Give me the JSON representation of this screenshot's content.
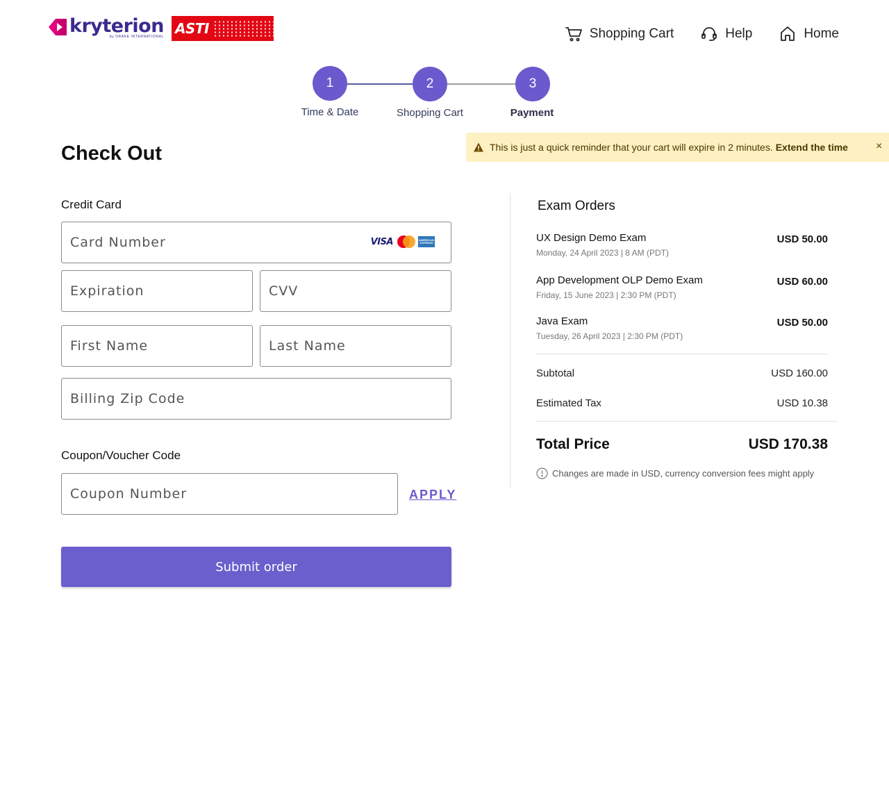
{
  "brand": {
    "logo_name": "kryterion",
    "logo_tagline": "by DRAKE INTERNATIONAL",
    "partner_logo": "ASTI",
    "accent_color": "#6a5acd",
    "partner_color": "#e30613"
  },
  "nav": {
    "items": [
      {
        "label": "Shopping Cart",
        "icon": "cart-icon"
      },
      {
        "label": "Help",
        "icon": "headset-icon"
      },
      {
        "label": "Home",
        "icon": "home-icon"
      }
    ]
  },
  "stepper": {
    "steps": [
      {
        "number": "1",
        "label": "Time & Date",
        "state": "completed"
      },
      {
        "number": "2",
        "label": "Shopping Cart",
        "state": "completed"
      },
      {
        "number": "3",
        "label": "Payment",
        "state": "current"
      }
    ]
  },
  "alert": {
    "message": "This is just a quick reminder that your cart will expire in 2 minutes.",
    "action": "Extend the time",
    "close": "×",
    "icon": "warning-icon",
    "background": "#fdf0c2"
  },
  "checkout": {
    "title": "Check Out",
    "credit_card_label": "Credit Card",
    "fields": {
      "card_number": {
        "placeholder": "Card Number",
        "value": ""
      },
      "expiration": {
        "placeholder": "Expiration",
        "value": ""
      },
      "cvv": {
        "placeholder": "CVV",
        "value": ""
      },
      "first_name": {
        "placeholder": "First Name",
        "value": ""
      },
      "last_name": {
        "placeholder": "Last Name",
        "value": ""
      },
      "zip": {
        "placeholder": "Billing Zip Code",
        "value": ""
      }
    },
    "card_brands": [
      "VISA",
      "mastercard",
      "AMERICAN EXPRESS"
    ],
    "coupon_label": "Coupon/Voucher Code",
    "coupon": {
      "placeholder": "Coupon Number",
      "value": ""
    },
    "apply_label": "APPLY",
    "submit_label": "Submit order"
  },
  "orders": {
    "title": "Exam Orders",
    "items": [
      {
        "name": "UX Design Demo Exam",
        "date": "Monday, 24 April 2023 | 8 AM (PDT)",
        "price": "USD 50.00"
      },
      {
        "name": "App Development OLP Demo Exam",
        "date": "Friday, 15 June 2023 | 2:30 PM (PDT)",
        "price": "USD 60.00"
      },
      {
        "name": "Java Exam",
        "date": "Tuesday, 26 April 2023 | 2:30 PM (PDT)",
        "price": "USD 50.00"
      }
    ],
    "subtotal_label": "Subtotal",
    "subtotal_value": "USD 160.00",
    "tax_label": "Estimated Tax",
    "tax_value": "USD 10.38",
    "total_label": "Total Price",
    "total_value": "USD 170.38",
    "note": "Changes are made in USD, currency conversion fees might apply",
    "note_icon": "info-icon"
  }
}
